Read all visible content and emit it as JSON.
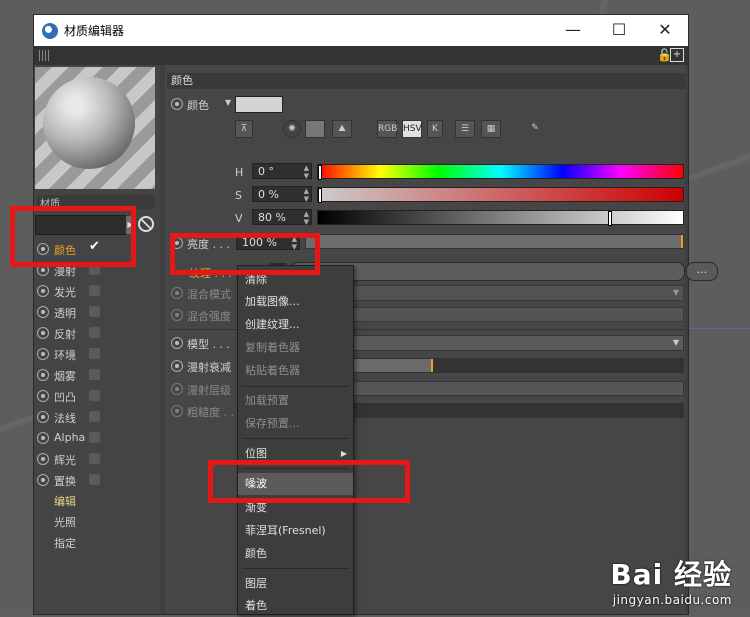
{
  "window": {
    "title": "材质编辑器",
    "min": "—",
    "max": "☐",
    "close": "✕"
  },
  "left": {
    "material_label": "材质",
    "channels": [
      {
        "label": "颜色",
        "checked": true
      },
      {
        "label": "漫射"
      },
      {
        "label": "发光"
      },
      {
        "label": "透明"
      },
      {
        "label": "反射"
      },
      {
        "label": "环境"
      },
      {
        "label": "烟雾"
      },
      {
        "label": "凹凸"
      },
      {
        "label": "法线"
      },
      {
        "label": "Alpha"
      },
      {
        "label": "辉光"
      },
      {
        "label": "置换"
      }
    ],
    "sub": [
      "编辑",
      "光照",
      "指定"
    ]
  },
  "right": {
    "section_title": "颜色",
    "color_label": "颜色",
    "mode_icons": [
      "RGB",
      "HSV",
      "K"
    ],
    "h": {
      "label": "H",
      "value": "0 °"
    },
    "s": {
      "label": "S",
      "value": "0 %"
    },
    "v": {
      "label": "V",
      "value": "80 %"
    },
    "brightness": {
      "label": "亮度 . . .",
      "value": "100 %"
    },
    "texture": {
      "label": "纹理 . . .",
      "more": "..."
    },
    "mix_mode": "混合模式",
    "mix_strength": "混合强度",
    "model": "模型 . . .",
    "diffuse_falloff": "漫射衰减",
    "diffuse_level": "漫射层级",
    "roughness": "粗糙度 . . ."
  },
  "menu": {
    "items": [
      "清除",
      "加载图像...",
      "创建纹理...",
      "复制着色器",
      "粘贴着色器",
      "加载预置",
      "保存预置...",
      "位图",
      "噪波",
      "渐变",
      "菲涅耳(Fresnel)",
      "颜色",
      "图层",
      "着色"
    ]
  },
  "watermark": {
    "logo": "Bai 经验",
    "url": "jingyan.baidu.com"
  }
}
